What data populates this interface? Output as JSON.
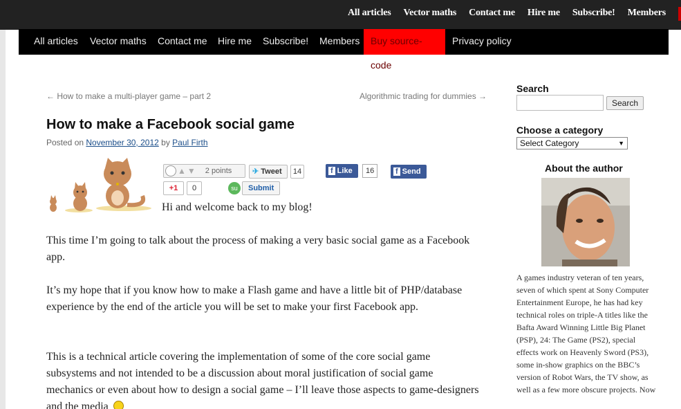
{
  "topbar": {
    "links": [
      "All articles",
      "Vector maths",
      "Contact me",
      "Hire me",
      "Subscribe!",
      "Members"
    ]
  },
  "mainnav": {
    "items": [
      "All articles",
      "Vector maths",
      "Contact me",
      "Hire me",
      "Subscribe!",
      "Members",
      "Buy source-code",
      "Privacy policy"
    ],
    "highlight_index": 6,
    "highlight_color": "#ff0000"
  },
  "post": {
    "prev_link": "← How to make a multi-player game – part 2",
    "next_link": "Algorithmic trading for dummies →",
    "title": "How to make a Facebook social game",
    "posted_on": "Posted on",
    "date": "November 30, 2012",
    "by": "by",
    "author": "Paul Firth",
    "intro": "Hi and welcome back to my blog!",
    "paragraphs": [
      "This time I’m going to talk about the process of making a very basic social game as a Facebook app.",
      "It’s my hope that if you know how to make a Flash game and have a little bit of PHP/database experience by the end of the article you will be set to make your first Facebook app.",
      "This is a technical article covering the implementation of some of the core social game subsystems and not intended to be a discussion about moral justification of social game mechanics or even about how to design a social game – I’ll leave those aspects to game-designers and the media"
    ]
  },
  "social": {
    "reddit_points": "2 points",
    "tweet_label": "Tweet",
    "tweet_count": "14",
    "like_label": "Like",
    "like_count": "16",
    "send_label": "Send",
    "gplus_label": "+1",
    "gplus_count": "0",
    "stumble_label": "Submit"
  },
  "sidebar": {
    "search_heading": "Search",
    "search_button": "Search",
    "category_heading": "Choose a category",
    "category_selected": "Select Category",
    "author_heading": "About the author",
    "bio": "A games industry veteran of ten years, seven of which spent at Sony Computer Entertainment Europe, he has had key technical roles on triple-A titles like the Bafta Award Winning Little Big Planet (PSP), 24: The Game (PS2), special effects work on Heavenly Sword (PS3), some in-show graphics on the BBC’s version of Robot Wars, the TV show, as well as a few more obscure projects.   Now"
  }
}
